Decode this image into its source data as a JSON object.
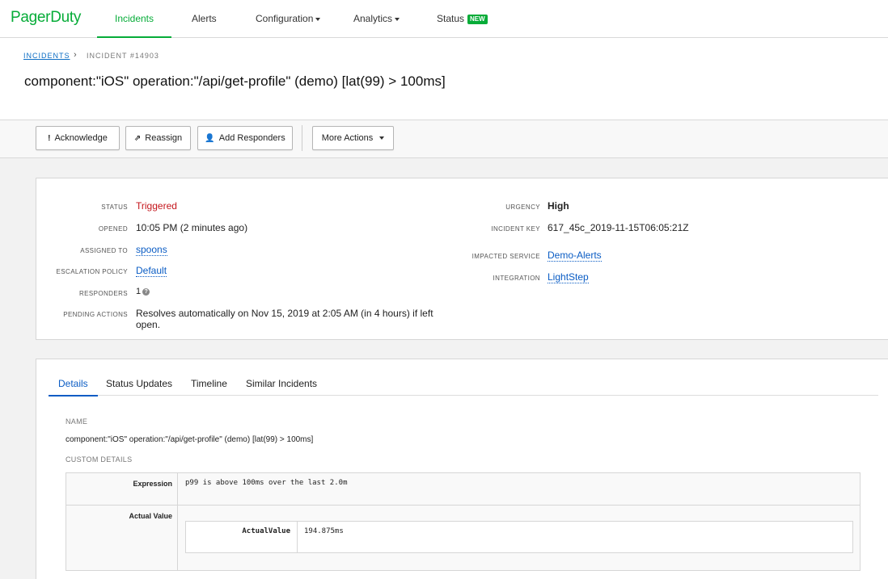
{
  "nav": {
    "logo": "PagerDuty",
    "items": [
      "Incidents",
      "Alerts",
      "Configuration",
      "Analytics",
      "Status"
    ],
    "status_badge": "NEW",
    "accent_color": "#06ac38"
  },
  "breadcrumb": {
    "parent": "INCIDENTS",
    "current": "INCIDENT #14903"
  },
  "incident_title": "component:\"iOS\" operation:\"/api/get-profile\" (demo) [lat(99) > 100ms]",
  "toolbar": {
    "acknowledge": "Acknowledge",
    "reassign": "Reassign",
    "add_responders": "Add Responders",
    "more_actions": "More Actions"
  },
  "summary": {
    "status_label": "STATUS",
    "status": "Triggered",
    "opened_label": "OPENED",
    "opened": "10:05 PM (2 minutes ago)",
    "assigned_label": "ASSIGNED TO",
    "assigned": "spoons",
    "escalation_label": "ESCALATION POLICY",
    "escalation": "Default",
    "responders_label": "RESPONDERS",
    "responders": "1",
    "pending_label": "PENDING ACTIONS",
    "pending": "Resolves automatically on Nov 15, 2019 at 2:05 AM (in 4 hours) if left open.",
    "urgency_label": "URGENCY",
    "urgency": "High",
    "key_label": "INCIDENT KEY",
    "key": "617_45c_2019-11-15T06:05:21Z",
    "service_label": "IMPACTED SERVICE",
    "service": "Demo-Alerts",
    "integration_label": "INTEGRATION",
    "integration": "LightStep"
  },
  "details": {
    "tabs": [
      "Details",
      "Status Updates",
      "Timeline",
      "Similar Incidents"
    ],
    "name_label": "NAME",
    "name": "component:\"iOS\" operation:\"/api/get-profile\" (demo) [lat(99) > 100ms]",
    "custom_label": "CUSTOM DETAILS",
    "expression_key": "Expression",
    "expression_value": "p99 is above 100ms over the last 2.0m",
    "actual_key": "Actual Value",
    "inner_key": "ActualValue",
    "inner_value": "194.875ms"
  }
}
